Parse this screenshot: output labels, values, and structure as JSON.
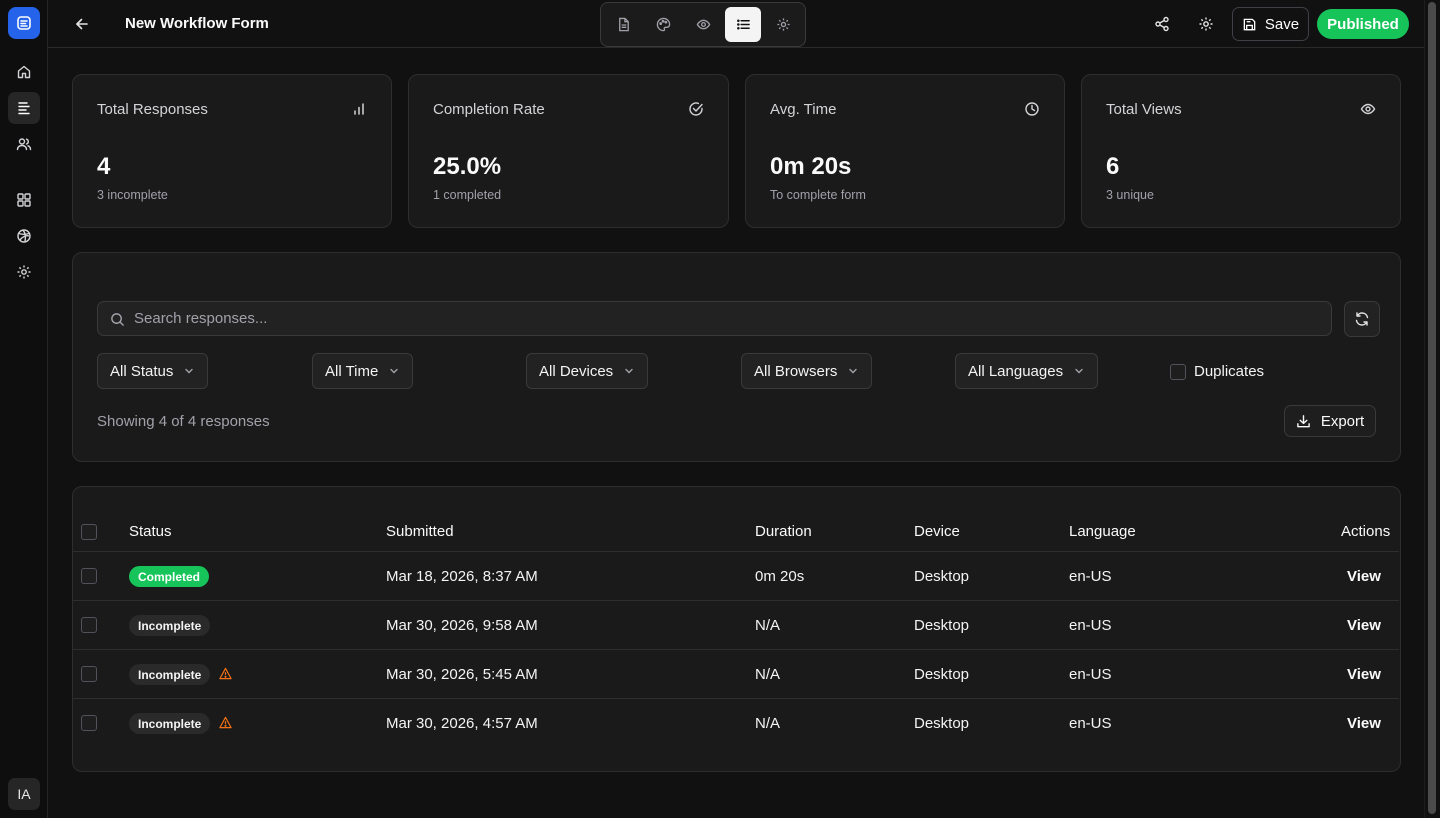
{
  "header": {
    "title": "New Workflow Form",
    "save_label": "Save",
    "published_label": "Published"
  },
  "user": {
    "initials": "IA"
  },
  "stats": [
    {
      "label": "Total Responses",
      "value": "4",
      "sub": "3 incomplete",
      "icon": "bar-chart-icon"
    },
    {
      "label": "Completion Rate",
      "value": "25.0%",
      "sub": "1 completed",
      "icon": "check-circle-icon"
    },
    {
      "label": "Avg. Time",
      "value": "0m 20s",
      "sub": "To complete form",
      "icon": "clock-icon"
    },
    {
      "label": "Total Views",
      "value": "6",
      "sub": "3 unique",
      "icon": "eye-icon"
    }
  ],
  "filters": {
    "search_placeholder": "Search responses...",
    "status": "All Status",
    "time": "All Time",
    "devices": "All Devices",
    "browsers": "All Browsers",
    "languages": "All Languages",
    "duplicates_label": "Duplicates",
    "showing": "Showing 4 of 4 responses",
    "export_label": "Export"
  },
  "table": {
    "columns": [
      "Status",
      "Submitted",
      "Duration",
      "Device",
      "Language",
      "Actions"
    ],
    "rows": [
      {
        "status": "Completed",
        "submitted": "Mar 18, 2026, 8:37 AM",
        "duration": "0m 20s",
        "device": "Desktop",
        "language": "en-US",
        "action": "View",
        "warning": false
      },
      {
        "status": "Incomplete",
        "submitted": "Mar 30, 2026, 9:58 AM",
        "duration": "N/A",
        "device": "Desktop",
        "language": "en-US",
        "action": "View",
        "warning": false
      },
      {
        "status": "Incomplete",
        "submitted": "Mar 30, 2026, 5:45 AM",
        "duration": "N/A",
        "device": "Desktop",
        "language": "en-US",
        "action": "View",
        "warning": true
      },
      {
        "status": "Incomplete",
        "submitted": "Mar 30, 2026, 4:57 AM",
        "duration": "N/A",
        "device": "Desktop",
        "language": "en-US",
        "action": "View",
        "warning": true
      }
    ]
  },
  "colors": {
    "accent": "#2563eb",
    "success": "#16c45a",
    "warning": "#f97316",
    "background": "#111111"
  }
}
